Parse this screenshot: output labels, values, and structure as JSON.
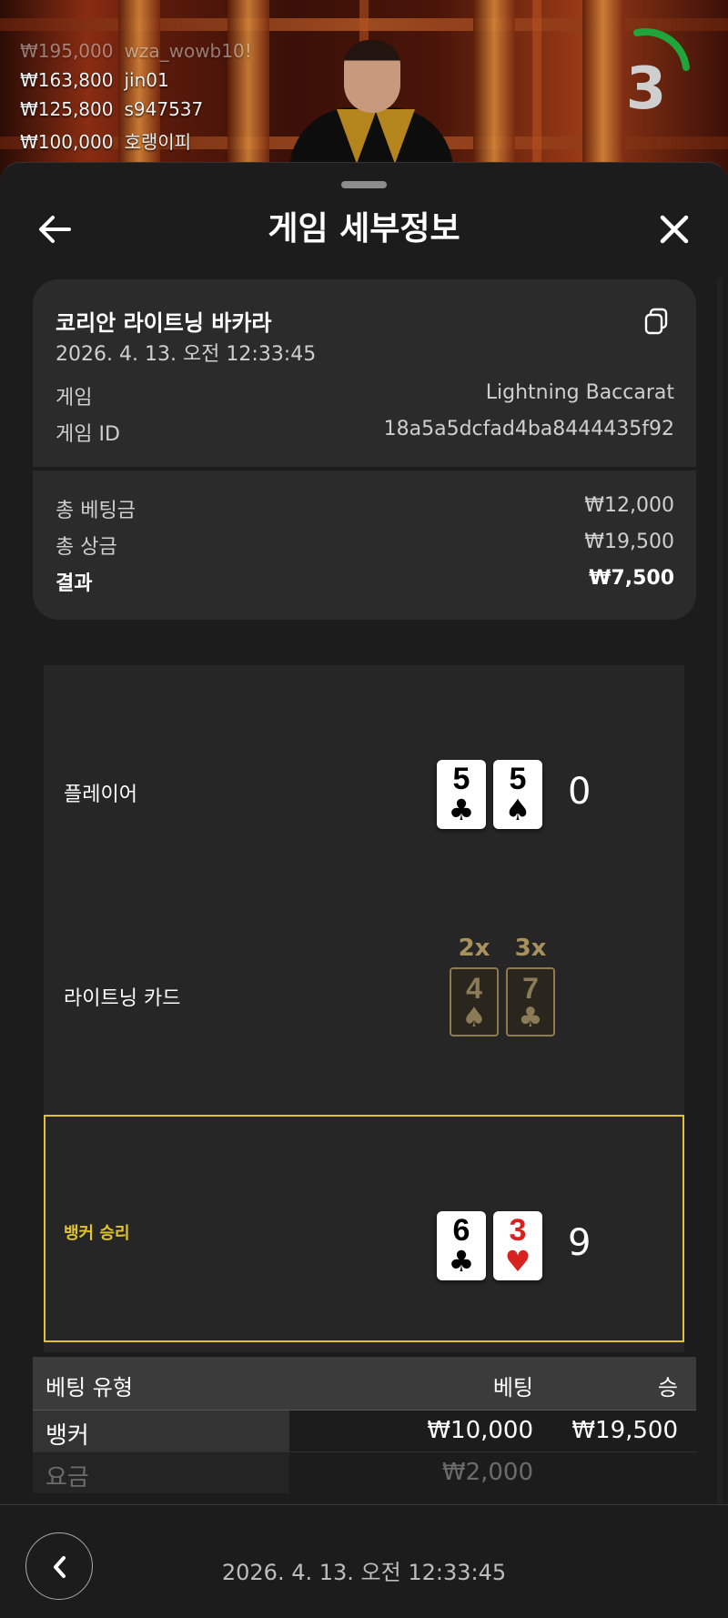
{
  "video": {
    "recent_winners": [
      {
        "amount": "₩195,000",
        "name": "wza_wowb10!",
        "faded": true
      },
      {
        "amount": "₩163,800",
        "name": "jin01",
        "faded": false
      },
      {
        "amount": "₩125,800",
        "name": "s947537",
        "faded": false
      },
      {
        "amount": "₩100,000",
        "name": "호랭이피",
        "faded": false
      }
    ],
    "countdown": "3"
  },
  "header": {
    "title": "게임 세부정보",
    "back_icon": "arrow-left-icon",
    "close_icon": "close-icon"
  },
  "game_info": {
    "name": "코리안 라이트닝 바카라",
    "datetime": "2026. 4. 13. 오전 12:33:45",
    "copy_icon": "copy-icon",
    "game_label": "게임",
    "game_value": "Lightning Baccarat",
    "id_label": "게임 ID",
    "id_value": "18a5a5dcfad4ba8444435f92",
    "total_bet_label": "총 베팅금",
    "total_bet_value": "₩12,000",
    "total_win_label": "총 상금",
    "total_win_value": "₩19,500",
    "result_label": "결과",
    "result_value": "₩7,500"
  },
  "round": {
    "player": {
      "label": "플레이어",
      "cards": [
        {
          "rank": "5",
          "suit": "♣",
          "color": "black"
        },
        {
          "rank": "5",
          "suit": "♠",
          "color": "black"
        }
      ],
      "score": "0"
    },
    "lightning": {
      "label": "라이트닝 카드",
      "cards": [
        {
          "rank": "4",
          "suit": "♠",
          "multiplier": "2x"
        },
        {
          "rank": "7",
          "suit": "♣",
          "multiplier": "3x"
        }
      ]
    },
    "banker": {
      "label": "뱅커 승리",
      "cards": [
        {
          "rank": "6",
          "suit": "♣",
          "color": "black"
        },
        {
          "rank": "3",
          "suit": "♥",
          "color": "red"
        }
      ],
      "score": "9",
      "highlight_color": "#e1c42d"
    }
  },
  "bets_table": {
    "headers": {
      "type": "베팅 유형",
      "bet": "베팅",
      "win": "승"
    },
    "rows": [
      {
        "type": "뱅커",
        "bet": "₩10,000",
        "win": "₩19,500"
      },
      {
        "type": "요금",
        "bet": "₩2,000",
        "win": ""
      }
    ]
  },
  "footer": {
    "back_icon": "chevron-left-icon",
    "datetime": "2026. 4. 13. 오전 12:33:45"
  }
}
